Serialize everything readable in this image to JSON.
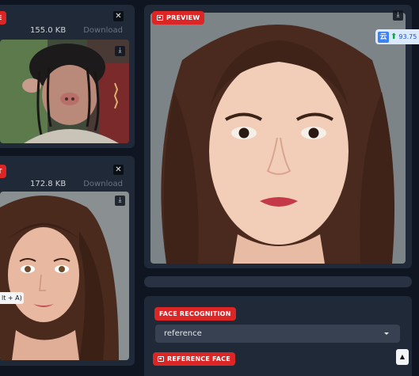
{
  "source_panel": {
    "badge_label": "E",
    "size": "155.0 KB",
    "download_label": "Download",
    "close_symbol": "✕",
    "download_icon": "download-icon"
  },
  "target_panel": {
    "badge_label": "T",
    "size": "172.8 KB",
    "download_label": "Download",
    "close_symbol": "✕",
    "download_icon": "download-icon"
  },
  "preview_panel": {
    "badge_label": "PREVIEW",
    "download_icon": "download-icon"
  },
  "floating_widget": {
    "icon_text": "云",
    "value": "93.75"
  },
  "tooltip_text": "lt + A)",
  "options": {
    "face_recognition_label": "FACE RECOGNITION",
    "face_recognition_value": "reference",
    "reference_face_label": "REFERENCE FACE"
  },
  "colors": {
    "accent": "#dc2626",
    "panel": "#1f2937",
    "background": "#0f1622"
  }
}
